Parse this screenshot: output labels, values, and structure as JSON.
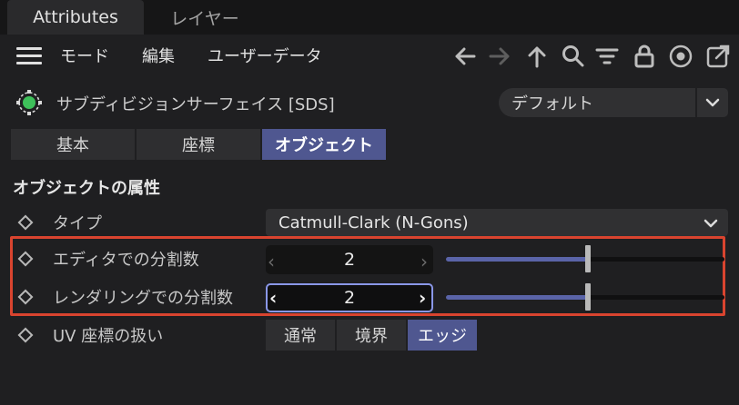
{
  "tabs": [
    {
      "label": "Attributes",
      "active": true
    },
    {
      "label": "レイヤー",
      "active": false
    }
  ],
  "menu": {
    "items": [
      "モード",
      "編集",
      "ユーザーデータ"
    ]
  },
  "toolbar": {
    "icons": [
      "back-arrow-icon",
      "forward-arrow-icon",
      "up-arrow-icon",
      "search-icon",
      "filter-icon",
      "lock-icon",
      "target-icon",
      "new-window-icon"
    ]
  },
  "object": {
    "name": "サブディビジョンサーフェイス [SDS]",
    "preset": "デフォルト"
  },
  "category_tabs": [
    {
      "label": "基本",
      "active": false
    },
    {
      "label": "座標",
      "active": false
    },
    {
      "label": "オブジェクト",
      "active": true
    }
  ],
  "section": {
    "title": "オブジェクトの属性"
  },
  "params": {
    "type": {
      "label": "タイプ",
      "value": "Catmull-Clark (N-Gons)"
    },
    "editor_subdiv": {
      "label": "エディタでの分割数",
      "value": "2",
      "slider_fraction": 0.51
    },
    "render_subdiv": {
      "label": "レンダリングでの分割数",
      "value": "2",
      "slider_fraction": 0.51
    },
    "uv": {
      "label": "UV 座標の扱い",
      "options": [
        "通常",
        "境界",
        "エッジ"
      ],
      "selected": "エッジ"
    }
  },
  "colors": {
    "accent": "#4f5790",
    "highlight_border": "#d9442f",
    "status_green": "#3ec05a"
  }
}
